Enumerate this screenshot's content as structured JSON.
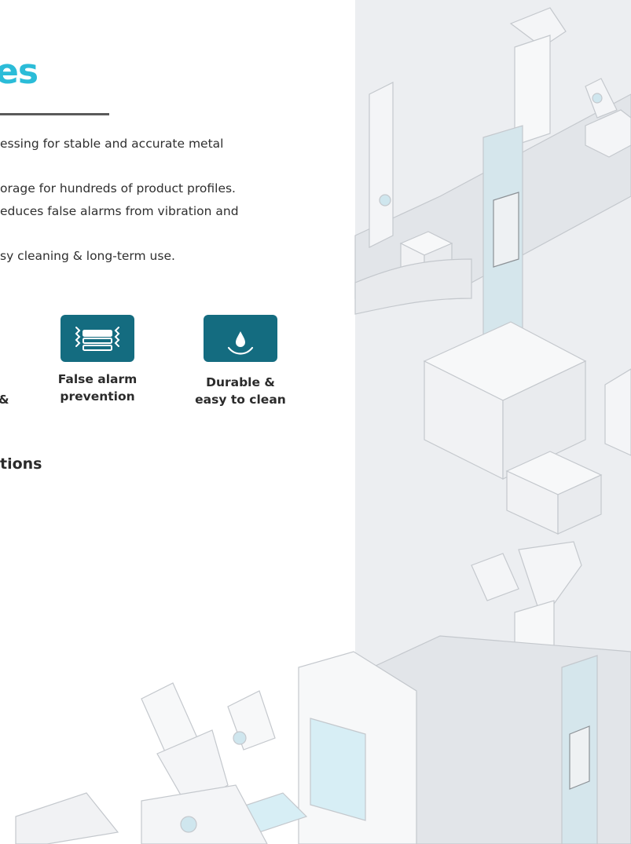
{
  "heading": {
    "text": "es"
  },
  "features_text": {
    "line1": "essing for stable and accurate metal",
    "line2": "orage for hundreds of product profiles.",
    "line3": "educes false alarms from vibration and",
    "line4": "sy cleaning & long-term use."
  },
  "features": [
    {
      "label_line1": "",
      "label_line2": "&",
      "icon": "partial-feature-icon"
    },
    {
      "label_line1": "False alarm",
      "label_line2": "prevention",
      "icon": "vibration-stack-icon"
    },
    {
      "label_line1": "Durable &",
      "label_line2": "easy to clean",
      "icon": "water-drop-icon"
    }
  ],
  "section": {
    "title": "tions"
  },
  "colors": {
    "accent": "#2bbcd8",
    "tile": "#146c80",
    "panel": "#eceef1"
  }
}
